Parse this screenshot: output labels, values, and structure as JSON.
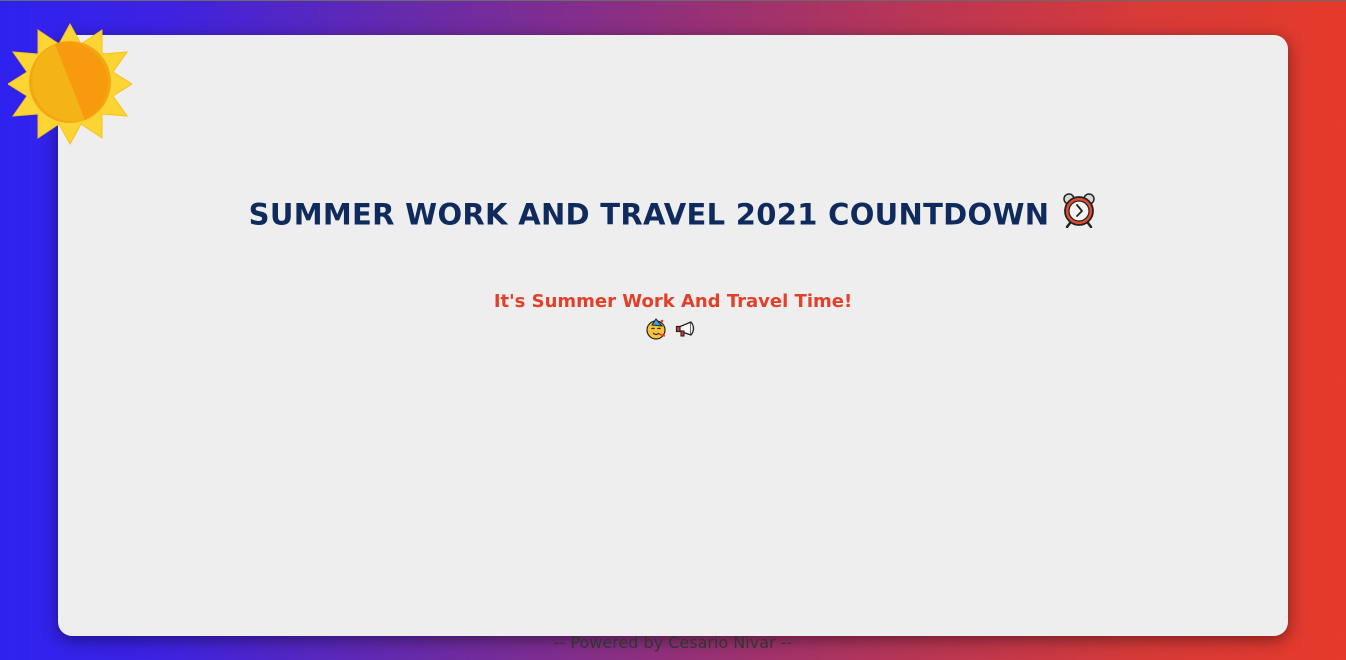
{
  "title": {
    "text": "SUMMER WORK AND TRAVEL 2021 COUNTDOWN",
    "icon": "alarm-clock-icon"
  },
  "message": {
    "text": "It's Summer Work And Travel Time!",
    "icons": [
      "partying-face-icon",
      "megaphone-icon"
    ]
  },
  "footer": {
    "text": "-- Powered by Cesario Nivar --"
  },
  "decor": {
    "sun_icon": "sun-icon"
  },
  "colors": {
    "title": "#0f2a5c",
    "accent": "#e2402b",
    "card_bg": "#eeeeee",
    "gradient_left": "#2e22f0",
    "gradient_right": "#e53a2b"
  }
}
